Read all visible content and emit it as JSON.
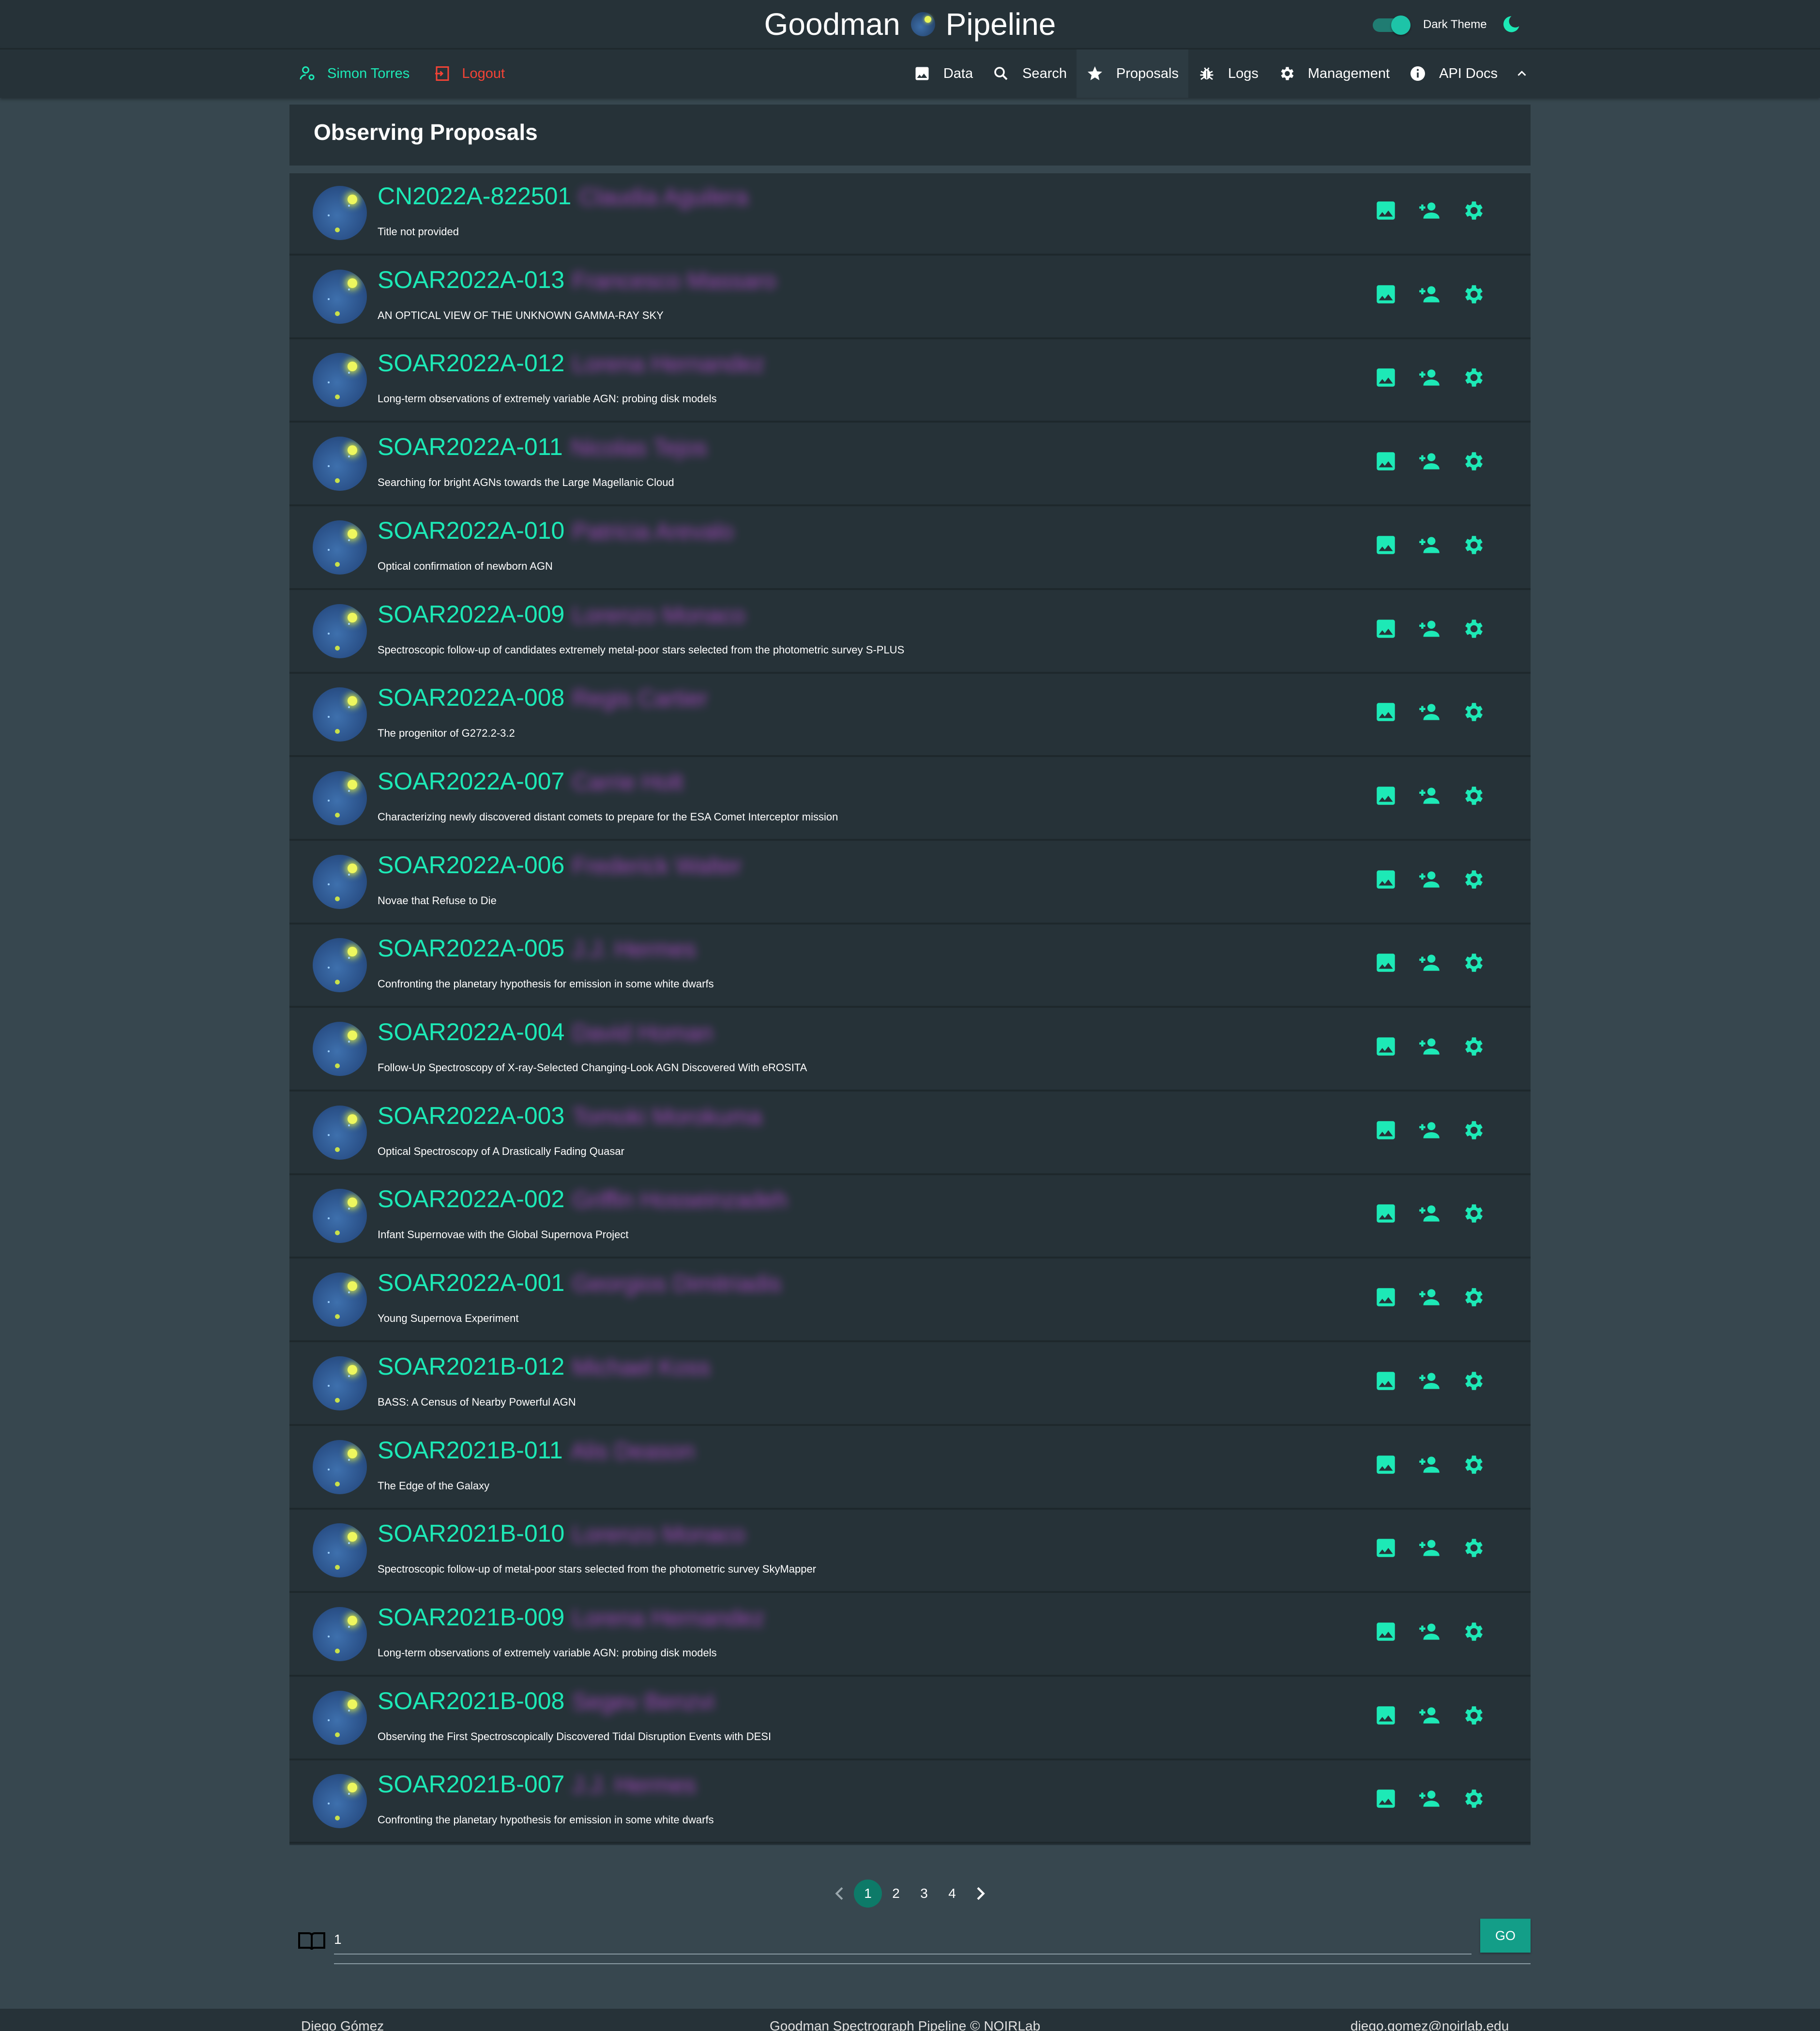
{
  "app": {
    "title_left": "Goodman",
    "title_right": "Pipeline",
    "theme_label": "Dark Theme",
    "accent_color": "#1de9b6",
    "logout_color": "#f44336"
  },
  "nav": {
    "user_name": "Simon Torres",
    "logout_label": "Logout",
    "items": [
      {
        "label": "Data",
        "icon": "image-icon"
      },
      {
        "label": "Search",
        "icon": "search-icon"
      },
      {
        "label": "Proposals",
        "icon": "star-icon"
      },
      {
        "label": "Logs",
        "icon": "bug-icon"
      },
      {
        "label": "Management",
        "icon": "gear-icon"
      },
      {
        "label": "API Docs",
        "icon": "info-icon"
      }
    ]
  },
  "page": {
    "title": "Observing Proposals"
  },
  "proposals": [
    {
      "code": "CN2022A-822501",
      "pi": "Claudia Aguilera",
      "title": "Title not provided"
    },
    {
      "code": "SOAR2022A-013",
      "pi": "Francesco Massaro",
      "title": "AN OPTICAL VIEW OF THE UNKNOWN GAMMA-RAY SKY"
    },
    {
      "code": "SOAR2022A-012",
      "pi": "Lorena Hernandez",
      "title": "Long-term observations of extremely variable AGN: probing disk models"
    },
    {
      "code": "SOAR2022A-011",
      "pi": "Nicolas Tejos",
      "title": "Searching for bright AGNs towards the Large Magellanic Cloud"
    },
    {
      "code": "SOAR2022A-010",
      "pi": "Patricia Arevalo",
      "title": "Optical confirmation of newborn AGN"
    },
    {
      "code": "SOAR2022A-009",
      "pi": "Lorenzo Monaco",
      "title": "Spectroscopic follow-up of candidates extremely metal-poor stars selected from the photometric survey S-PLUS"
    },
    {
      "code": "SOAR2022A-008",
      "pi": "Regis Cartier",
      "title": "The progenitor of G272.2-3.2"
    },
    {
      "code": "SOAR2022A-007",
      "pi": "Carrie Holt",
      "title": "Characterizing newly discovered distant comets to prepare for the ESA Comet Interceptor mission"
    },
    {
      "code": "SOAR2022A-006",
      "pi": "Frederick Walter",
      "title": "Novae that Refuse to Die"
    },
    {
      "code": "SOAR2022A-005",
      "pi": "J.J. Hermes",
      "title": "Confronting the planetary hypothesis for emission in some white dwarfs"
    },
    {
      "code": "SOAR2022A-004",
      "pi": "David Homan",
      "title": "Follow-Up Spectroscopy of X-ray-Selected Changing-Look AGN Discovered With eROSITA"
    },
    {
      "code": "SOAR2022A-003",
      "pi": "Tomoki Morokuma",
      "title": "Optical Spectroscopy of A Drastically Fading Quasar"
    },
    {
      "code": "SOAR2022A-002",
      "pi": "Griffin Hosseinzadeh",
      "title": "Infant Supernovae with the Global Supernova Project"
    },
    {
      "code": "SOAR2022A-001",
      "pi": "Georgios Dimitriadis",
      "title": "Young Supernova Experiment"
    },
    {
      "code": "SOAR2021B-012",
      "pi": "Michael Koss",
      "title": "BASS: A Census of Nearby Powerful AGN"
    },
    {
      "code": "SOAR2021B-011",
      "pi": "Alis Deason",
      "title": "The Edge of the Galaxy"
    },
    {
      "code": "SOAR2021B-010",
      "pi": "Lorenzo Monaco",
      "title": "Spectroscopic follow-up of metal-poor stars selected from the photometric survey SkyMapper"
    },
    {
      "code": "SOAR2021B-009",
      "pi": "Lorena Hernandez",
      "title": "Long-term observations of extremely variable AGN: probing disk models"
    },
    {
      "code": "SOAR2021B-008",
      "pi": "Segev Benzvi",
      "title": "Observing the First Spectroscopically Discovered Tidal Disruption Events with DESI"
    },
    {
      "code": "SOAR2021B-007",
      "pi": "J.J. Hermes",
      "title": "Confronting the planetary hypothesis for emission in some white dwarfs"
    }
  ],
  "pagination": {
    "pages": [
      "1",
      "2",
      "3",
      "4"
    ],
    "current": "1",
    "jump_value": "1",
    "go_label": "GO"
  },
  "footer": {
    "left": "Diego Gómez",
    "center": "Goodman Spectrograph Pipeline © NOIRLab",
    "right": "diego.gomez@noirlab.edu"
  }
}
